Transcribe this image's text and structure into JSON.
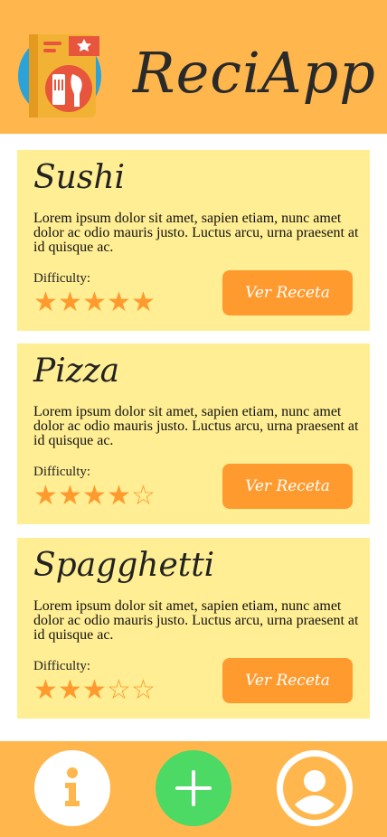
{
  "app": {
    "title": "ReciApp"
  },
  "recipes": [
    {
      "title": "Sushi",
      "description": "Lorem ipsum dolor sit amet, sapien etiam, nunc amet dolor ac odio mauris justo. Luctus arcu, urna praesent at id quisque ac.",
      "difficulty_label": "Difficulty:",
      "difficulty": 5,
      "difficulty_max": 5,
      "button_label": "Ver Receta"
    },
    {
      "title": "Pizza",
      "description": "Lorem ipsum dolor sit amet, sapien etiam, nunc amet dolor ac odio mauris justo. Luctus arcu, urna praesent at id quisque ac.",
      "difficulty_label": "Difficulty:",
      "difficulty": 4,
      "difficulty_max": 5,
      "button_label": "Ver Receta"
    },
    {
      "title": "Spagghetti",
      "description": "Lorem ipsum dolor sit amet, sapien etiam, nunc amet dolor ac odio mauris justo. Luctus arcu, urna praesent at id quisque ac.",
      "difficulty_label": "Difficulty:",
      "difficulty": 3,
      "difficulty_max": 5,
      "button_label": "Ver Receta"
    }
  ],
  "footer": {
    "buttons": [
      {
        "name": "info",
        "icon": "info-icon"
      },
      {
        "name": "add",
        "icon": "plus-icon"
      },
      {
        "name": "profile",
        "icon": "user-icon"
      }
    ]
  },
  "colors": {
    "header": "#FFB74D",
    "card": "#FFEE93",
    "accent": "#FF9A2E",
    "add": "#4CD964"
  }
}
